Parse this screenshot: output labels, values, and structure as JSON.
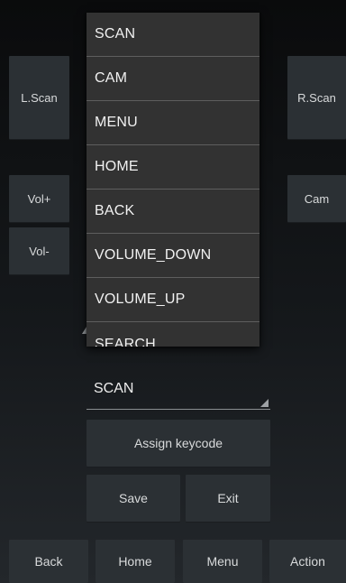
{
  "side_keys": {
    "left_scan": "L.Scan",
    "right_scan": "R.Scan",
    "vol_up": "Vol+",
    "vol_down": "Vol-",
    "cam": "Cam"
  },
  "dropdown": {
    "items": [
      "SCAN",
      "CAM",
      "MENU",
      "HOME",
      "BACK",
      "VOLUME_DOWN",
      "VOLUME_UP",
      "SEARCH"
    ]
  },
  "spinner": {
    "selected": "SCAN"
  },
  "actions": {
    "assign_keycode": "Assign keycode",
    "save": "Save",
    "exit": "Exit"
  },
  "nav": {
    "back": "Back",
    "home": "Home",
    "menu": "Menu",
    "action": "Action"
  }
}
